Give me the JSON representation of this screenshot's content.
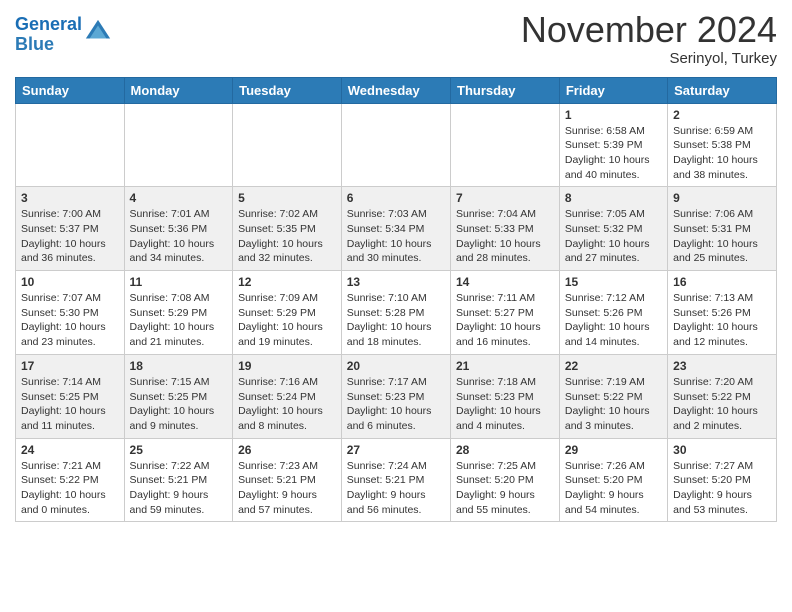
{
  "header": {
    "logo_line1": "General",
    "logo_line2": "Blue",
    "month": "November 2024",
    "location": "Serinyol, Turkey"
  },
  "weekdays": [
    "Sunday",
    "Monday",
    "Tuesday",
    "Wednesday",
    "Thursday",
    "Friday",
    "Saturday"
  ],
  "weeks": [
    [
      {
        "day": "",
        "content": ""
      },
      {
        "day": "",
        "content": ""
      },
      {
        "day": "",
        "content": ""
      },
      {
        "day": "",
        "content": ""
      },
      {
        "day": "",
        "content": ""
      },
      {
        "day": "1",
        "content": "Sunrise: 6:58 AM\nSunset: 5:39 PM\nDaylight: 10 hours and 40 minutes."
      },
      {
        "day": "2",
        "content": "Sunrise: 6:59 AM\nSunset: 5:38 PM\nDaylight: 10 hours and 38 minutes."
      }
    ],
    [
      {
        "day": "3",
        "content": "Sunrise: 7:00 AM\nSunset: 5:37 PM\nDaylight: 10 hours and 36 minutes."
      },
      {
        "day": "4",
        "content": "Sunrise: 7:01 AM\nSunset: 5:36 PM\nDaylight: 10 hours and 34 minutes."
      },
      {
        "day": "5",
        "content": "Sunrise: 7:02 AM\nSunset: 5:35 PM\nDaylight: 10 hours and 32 minutes."
      },
      {
        "day": "6",
        "content": "Sunrise: 7:03 AM\nSunset: 5:34 PM\nDaylight: 10 hours and 30 minutes."
      },
      {
        "day": "7",
        "content": "Sunrise: 7:04 AM\nSunset: 5:33 PM\nDaylight: 10 hours and 28 minutes."
      },
      {
        "day": "8",
        "content": "Sunrise: 7:05 AM\nSunset: 5:32 PM\nDaylight: 10 hours and 27 minutes."
      },
      {
        "day": "9",
        "content": "Sunrise: 7:06 AM\nSunset: 5:31 PM\nDaylight: 10 hours and 25 minutes."
      }
    ],
    [
      {
        "day": "10",
        "content": "Sunrise: 7:07 AM\nSunset: 5:30 PM\nDaylight: 10 hours and 23 minutes."
      },
      {
        "day": "11",
        "content": "Sunrise: 7:08 AM\nSunset: 5:29 PM\nDaylight: 10 hours and 21 minutes."
      },
      {
        "day": "12",
        "content": "Sunrise: 7:09 AM\nSunset: 5:29 PM\nDaylight: 10 hours and 19 minutes."
      },
      {
        "day": "13",
        "content": "Sunrise: 7:10 AM\nSunset: 5:28 PM\nDaylight: 10 hours and 18 minutes."
      },
      {
        "day": "14",
        "content": "Sunrise: 7:11 AM\nSunset: 5:27 PM\nDaylight: 10 hours and 16 minutes."
      },
      {
        "day": "15",
        "content": "Sunrise: 7:12 AM\nSunset: 5:26 PM\nDaylight: 10 hours and 14 minutes."
      },
      {
        "day": "16",
        "content": "Sunrise: 7:13 AM\nSunset: 5:26 PM\nDaylight: 10 hours and 12 minutes."
      }
    ],
    [
      {
        "day": "17",
        "content": "Sunrise: 7:14 AM\nSunset: 5:25 PM\nDaylight: 10 hours and 11 minutes."
      },
      {
        "day": "18",
        "content": "Sunrise: 7:15 AM\nSunset: 5:25 PM\nDaylight: 10 hours and 9 minutes."
      },
      {
        "day": "19",
        "content": "Sunrise: 7:16 AM\nSunset: 5:24 PM\nDaylight: 10 hours and 8 minutes."
      },
      {
        "day": "20",
        "content": "Sunrise: 7:17 AM\nSunset: 5:23 PM\nDaylight: 10 hours and 6 minutes."
      },
      {
        "day": "21",
        "content": "Sunrise: 7:18 AM\nSunset: 5:23 PM\nDaylight: 10 hours and 4 minutes."
      },
      {
        "day": "22",
        "content": "Sunrise: 7:19 AM\nSunset: 5:22 PM\nDaylight: 10 hours and 3 minutes."
      },
      {
        "day": "23",
        "content": "Sunrise: 7:20 AM\nSunset: 5:22 PM\nDaylight: 10 hours and 2 minutes."
      }
    ],
    [
      {
        "day": "24",
        "content": "Sunrise: 7:21 AM\nSunset: 5:22 PM\nDaylight: 10 hours and 0 minutes."
      },
      {
        "day": "25",
        "content": "Sunrise: 7:22 AM\nSunset: 5:21 PM\nDaylight: 9 hours and 59 minutes."
      },
      {
        "day": "26",
        "content": "Sunrise: 7:23 AM\nSunset: 5:21 PM\nDaylight: 9 hours and 57 minutes."
      },
      {
        "day": "27",
        "content": "Sunrise: 7:24 AM\nSunset: 5:21 PM\nDaylight: 9 hours and 56 minutes."
      },
      {
        "day": "28",
        "content": "Sunrise: 7:25 AM\nSunset: 5:20 PM\nDaylight: 9 hours and 55 minutes."
      },
      {
        "day": "29",
        "content": "Sunrise: 7:26 AM\nSunset: 5:20 PM\nDaylight: 9 hours and 54 minutes."
      },
      {
        "day": "30",
        "content": "Sunrise: 7:27 AM\nSunset: 5:20 PM\nDaylight: 9 hours and 53 minutes."
      }
    ]
  ]
}
